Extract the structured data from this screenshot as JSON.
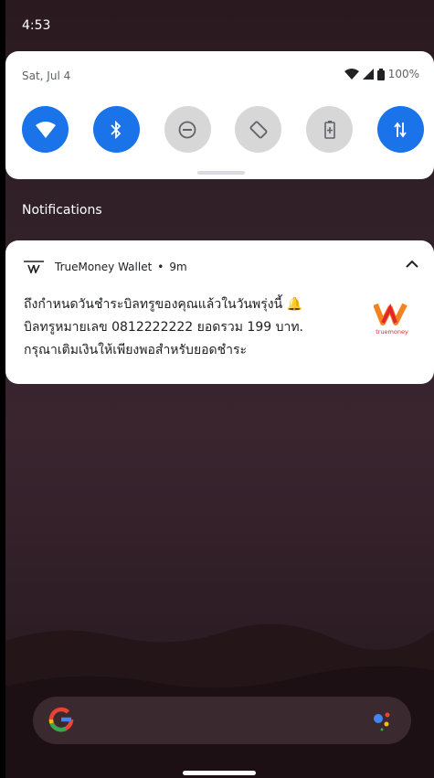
{
  "status_bar": {
    "time": "4:53"
  },
  "quick_settings": {
    "date": "Sat, Jul 4",
    "battery_percent": "100%",
    "tiles": [
      {
        "name": "wifi",
        "state": "on",
        "icon": "wifi-icon"
      },
      {
        "name": "bluetooth",
        "state": "on",
        "icon": "bluetooth-icon"
      },
      {
        "name": "do-not-disturb",
        "state": "off",
        "icon": "dnd-icon"
      },
      {
        "name": "auto-rotate",
        "state": "off",
        "icon": "rotate-icon"
      },
      {
        "name": "battery-saver",
        "state": "off",
        "icon": "battery-saver-icon"
      },
      {
        "name": "mobile-data",
        "state": "on",
        "icon": "mobile-data-icon"
      }
    ]
  },
  "notifications_heading": "Notifications",
  "notification": {
    "app_name": "TrueMoney Wallet",
    "time": "9m",
    "title": "ถึงกำหนดวันชำระบิลทรูของคุณแล้วในวันพรุ่งนี้ 🔔",
    "line2": "บิลทรูหมายเลข 0812222222 ยอดรวม 199 บาท.",
    "line3": "กรุณาเติมเงินให้เพียงพอสำหรับยอดชำระ",
    "logo_text": "truemoney"
  },
  "colors": {
    "accent": "#1a73e8",
    "tile_off": "#d7d7d7",
    "truemoney_orange": "#f5821f",
    "truemoney_red": "#e3262b"
  }
}
